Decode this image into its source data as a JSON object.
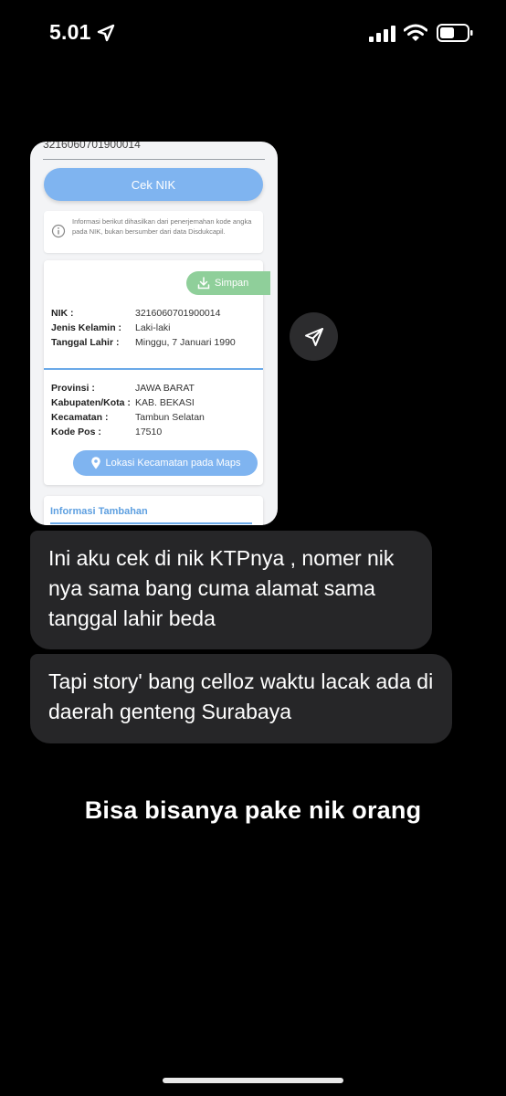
{
  "status_bar": {
    "time": "5.01",
    "icons": [
      "location-arrow-icon",
      "signal-icon",
      "wifi-icon",
      "battery-icon"
    ]
  },
  "shared_screenshot": {
    "nik_input_value": "3216060701900014",
    "cek_button_label": "Cek NIK",
    "info_text": "Informasi berikut dihasilkan dari penerjemahan kode angka pada NIK, bukan bersumber dari data Disdukcapil.",
    "simpan_label": "Simpan",
    "identity": [
      {
        "label": "NIK :",
        "value": "3216060701900014"
      },
      {
        "label": "Jenis Kelamin :",
        "value": "Laki-laki"
      },
      {
        "label": "Tanggal Lahir :",
        "value": "Minggu, 7 Januari 1990"
      }
    ],
    "location": [
      {
        "label": "Provinsi :",
        "value": "JAWA BARAT"
      },
      {
        "label": "Kabupaten/Kota :",
        "value": "KAB. BEKASI"
      },
      {
        "label": "Kecamatan :",
        "value": "Tambun Selatan"
      },
      {
        "label": "Kode Pos :",
        "value": "17510"
      }
    ],
    "maps_button_label": "Lokasi Kecamatan pada Maps",
    "extra_title": "Informasi Tambahan"
  },
  "messages": [
    {
      "text": "Ini aku cek di nik KTPnya , nomer nik nya sama bang cuma alamat sama tanggal lahir beda"
    },
    {
      "text": "Tapi story' bang celloz waktu lacak ada di daerah genteng Surabaya"
    }
  ],
  "caption": "Bisa bisanya pake nik orang",
  "colors": {
    "background": "#000000",
    "bubble": "#262628",
    "cek_button": "#7fb4f0",
    "simpan_button": "#8fcf9a",
    "accent_blue": "#6aa9e8"
  }
}
